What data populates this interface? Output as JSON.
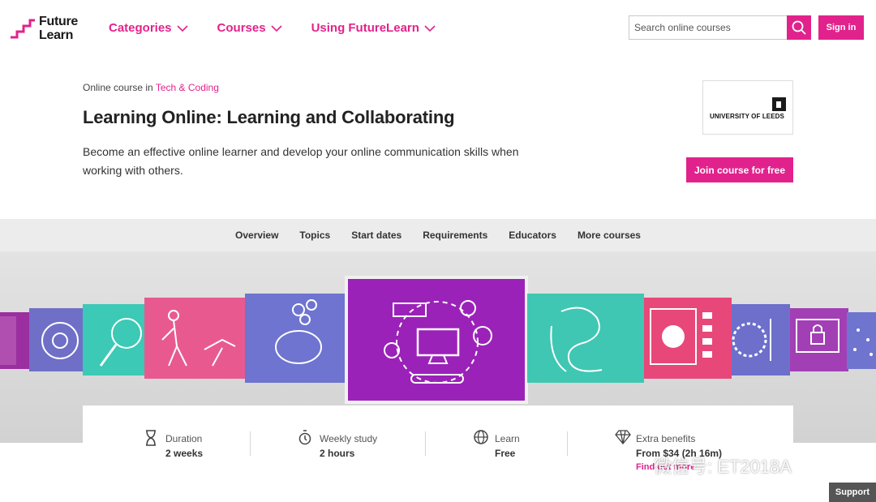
{
  "brand": {
    "logo_text": "Future\nLearn",
    "accent": "#e2228c"
  },
  "nav": {
    "items": [
      {
        "label": "Categories"
      },
      {
        "label": "Courses"
      },
      {
        "label": "Using FutureLearn"
      }
    ],
    "search_placeholder": "Search online courses",
    "sign_in": "Sign in"
  },
  "course": {
    "breadcrumb_prefix": "Online course in",
    "breadcrumb_link": "Tech & Coding",
    "title": "Learning Online: Learning and Collaborating",
    "description": "Become an effective online learner and develop your online communication skills when working with others.",
    "university": "UNIVERSITY OF LEEDS",
    "join_button": "Join course for free"
  },
  "tabs": [
    "Overview",
    "Topics",
    "Start dates",
    "Requirements",
    "Educators",
    "More courses"
  ],
  "hero": {
    "tile_colors": [
      "#9b2f9f",
      "#6f6fc8",
      "#3cc9b5",
      "#e85a8f",
      "#6e74cf",
      "#9b22b8",
      "#3fc7b3",
      "#e8477a",
      "#6d6fcb",
      "#a23fb5",
      "#6f74cf"
    ]
  },
  "info": {
    "duration": {
      "label": "Duration",
      "value": "2 weeks"
    },
    "weekly": {
      "label": "Weekly study",
      "value": "2 hours"
    },
    "learn": {
      "label": "Learn",
      "value": "Free"
    },
    "extra": {
      "label": "Extra benefits",
      "value": "From $34 (2h 16m)",
      "link": "Find out more"
    }
  },
  "watermark": "微信号: ET2018A",
  "support": "Support"
}
